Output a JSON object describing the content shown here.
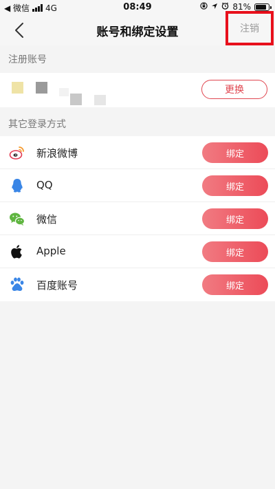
{
  "status_bar": {
    "back_app": "◀ 微信",
    "network": "4G",
    "time": "08:49",
    "battery": "81%",
    "battery_level": 0.81
  },
  "nav": {
    "title": "账号和绑定设置",
    "logout_label": "注销",
    "highlight_color": "#e8101c"
  },
  "registered_section": {
    "header": "注册账号",
    "change_label": "更换"
  },
  "methods_section": {
    "header": "其它登录方式",
    "items": [
      {
        "label": "新浪微博",
        "icon": "weibo-icon",
        "button": "绑定"
      },
      {
        "label": "QQ",
        "icon": "qq-icon",
        "button": "绑定"
      },
      {
        "label": "微信",
        "icon": "wechat-icon",
        "button": "绑定"
      },
      {
        "label": "Apple",
        "icon": "apple-icon",
        "button": "绑定"
      },
      {
        "label": "百度账号",
        "icon": "baidu-icon",
        "button": "绑定"
      }
    ]
  },
  "colors": {
    "accent": "#e0454f",
    "button_gradient_start": "#f17b82",
    "button_gradient_end": "#ec4b58",
    "background": "#f4f4f4"
  }
}
